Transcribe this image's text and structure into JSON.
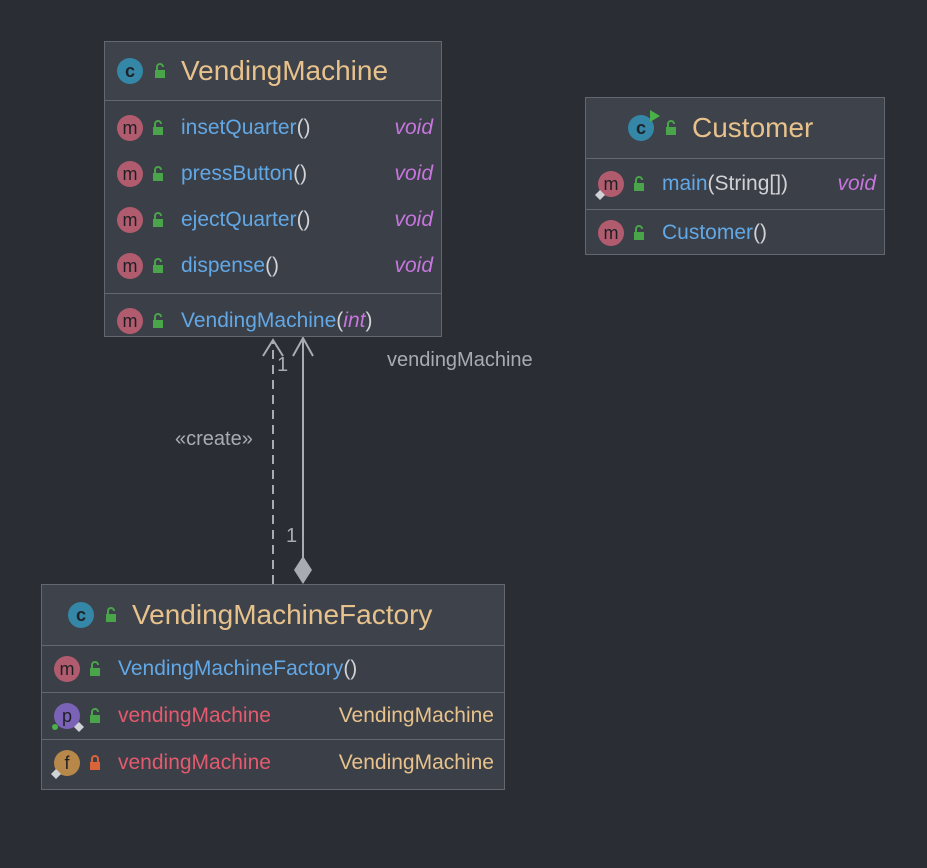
{
  "classes": {
    "vending_machine": {
      "title": "VendingMachine",
      "methods": [
        {
          "name": "insetQuarter",
          "parens": "()",
          "return": "void"
        },
        {
          "name": "pressButton",
          "parens": "()",
          "return": "void"
        },
        {
          "name": "ejectQuarter",
          "parens": "()",
          "return": "void"
        },
        {
          "name": "dispense",
          "parens": "()",
          "return": "void"
        }
      ],
      "constructor": {
        "name": "VendingMachine",
        "open": "(",
        "param": "int",
        "close": ")"
      }
    },
    "customer": {
      "title": "Customer",
      "methods": [
        {
          "name": "main",
          "args": "(String[])",
          "return": "void"
        }
      ],
      "constructor": {
        "name": "Customer",
        "parens": "()"
      }
    },
    "factory": {
      "title": "VendingMachineFactory",
      "constructor": {
        "name": "VendingMachineFactory",
        "parens": "()"
      },
      "property": {
        "name": "vendingMachine",
        "type": "VendingMachine"
      },
      "field": {
        "name": "vendingMachine",
        "type": "VendingMachine"
      }
    }
  },
  "relations": {
    "create_label": "«create»",
    "multiplicity_top": "1",
    "multiplicity_bottom": "1",
    "role_label": "vendingMachine"
  },
  "badges": {
    "method": "m",
    "class": "c",
    "property": "p",
    "field": "f"
  },
  "icons": {
    "public": "unlocked-padlock-icon",
    "private": "locked-padlock-icon"
  },
  "colors": {
    "background": "#2b2d35",
    "class_title": "#e8c28c",
    "method_name": "#62a8e6",
    "return_type": "#c675dd",
    "field_name": "#e45a6e",
    "type_name": "#e8c28c"
  }
}
